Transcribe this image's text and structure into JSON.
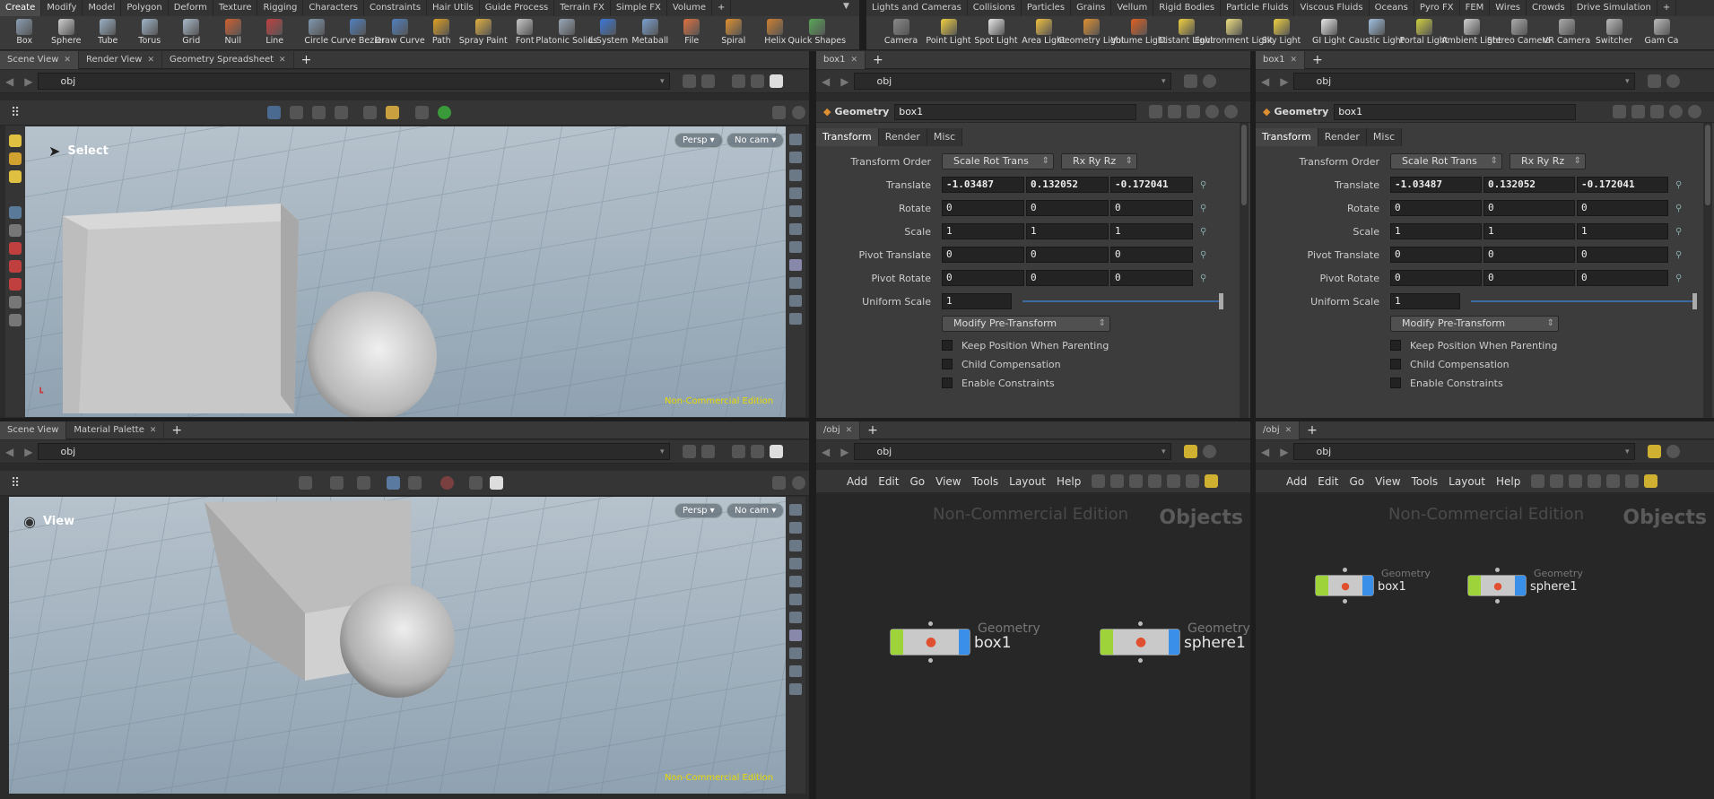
{
  "shelf_left": {
    "tabs": [
      "Create",
      "Modify",
      "Model",
      "Polygon",
      "Deform",
      "Texture",
      "Rigging",
      "Characters",
      "Constraints",
      "Hair Utils",
      "Guide Process",
      "Terrain FX",
      "Simple FX",
      "Volume"
    ],
    "tools": [
      {
        "label": "Box",
        "color": "#8a9fb4"
      },
      {
        "label": "Sphere",
        "color": "#d0d0d0"
      },
      {
        "label": "Tube",
        "color": "#9ab0c4"
      },
      {
        "label": "Torus",
        "color": "#a0b4c8"
      },
      {
        "label": "Grid",
        "color": "#a8b8c8"
      },
      {
        "label": "Null",
        "color": "#d06030"
      },
      {
        "label": "Line",
        "color": "#c04040"
      },
      {
        "label": "Circle",
        "color": "#8098b0"
      },
      {
        "label": "Curve Bezier",
        "color": "#5080c0"
      },
      {
        "label": "Draw Curve",
        "color": "#5080c0"
      },
      {
        "label": "Path",
        "color": "#e0a020"
      },
      {
        "label": "Spray Paint",
        "color": "#e0b040"
      },
      {
        "label": "Font",
        "color": "#c8c8c8"
      },
      {
        "label": "Platonic Solids",
        "color": "#9aa8b8"
      },
      {
        "label": "L-System",
        "color": "#3a78d8"
      },
      {
        "label": "Metaball",
        "color": "#7aa0d0"
      },
      {
        "label": "File",
        "color": "#e07040"
      },
      {
        "label": "Spiral",
        "color": "#e09030"
      },
      {
        "label": "Helix",
        "color": "#d08030"
      },
      {
        "label": "Quick Shapes",
        "color": "#58a858"
      }
    ]
  },
  "shelf_right": {
    "tabs": [
      "Lights and Cameras",
      "Collisions",
      "Particles",
      "Grains",
      "Vellum",
      "Rigid Bodies",
      "Particle Fluids",
      "Viscous Fluids",
      "Oceans",
      "Pyro FX",
      "FEM",
      "Wires",
      "Crowds",
      "Drive Simulation"
    ],
    "tools": [
      {
        "label": "Camera",
        "color": "#888"
      },
      {
        "label": "Point Light",
        "color": "#f0d040"
      },
      {
        "label": "Spot Light",
        "color": "#e8e8e8"
      },
      {
        "label": "Area Light",
        "color": "#f0c040"
      },
      {
        "label": "Geometry Light",
        "color": "#e09030"
      },
      {
        "label": "Volume Light",
        "color": "#e06020"
      },
      {
        "label": "Distant Light",
        "color": "#f0d040"
      },
      {
        "label": "Environment Light",
        "color": "#f0e080"
      },
      {
        "label": "Sky Light",
        "color": "#f0d040"
      },
      {
        "label": "GI Light",
        "color": "#e8e8e8"
      },
      {
        "label": "Caustic Light",
        "color": "#a0c0e0"
      },
      {
        "label": "Portal Light",
        "color": "#d0d040"
      },
      {
        "label": "Ambient Light",
        "color": "#d0d0d0"
      },
      {
        "label": "Stereo Camera",
        "color": "#aaa"
      },
      {
        "label": "VR Camera",
        "color": "#aaa"
      },
      {
        "label": "Switcher",
        "color": "#bbb"
      },
      {
        "label": "Gam Ca",
        "color": "#bbb"
      }
    ]
  },
  "top_left": {
    "tabs": [
      "Scene View",
      "Render View",
      "Geometry Spreadsheet"
    ],
    "path": "obj",
    "persp": "Persp",
    "cam": "No cam",
    "label": "Select",
    "watermark": "Non-Commercial Edition"
  },
  "bottom_left": {
    "tabs": [
      "Scene View",
      "Material Palette"
    ],
    "path": "obj",
    "persp": "Persp",
    "cam": "No cam",
    "label": "View",
    "watermark": "Non-Commercial Edition"
  },
  "params": {
    "tab": "box1",
    "path": "obj",
    "type": "Geometry",
    "node": "box1",
    "subtabs": [
      "Transform",
      "Render",
      "Misc"
    ],
    "transform_order_label": "Transform Order",
    "transform_order": "Scale Rot Trans",
    "rot_order": "Rx Ry Rz",
    "rows": [
      {
        "label": "Translate",
        "v": [
          "-1.03487",
          "0.132052",
          "-0.172041"
        ]
      },
      {
        "label": "Rotate",
        "v": [
          "0",
          "0",
          "0"
        ]
      },
      {
        "label": "Scale",
        "v": [
          "1",
          "1",
          "1"
        ]
      },
      {
        "label": "Pivot Translate",
        "v": [
          "0",
          "0",
          "0"
        ]
      },
      {
        "label": "Pivot Rotate",
        "v": [
          "0",
          "0",
          "0"
        ]
      }
    ],
    "uniform_label": "Uniform Scale",
    "uniform": "1",
    "pre": "Modify Pre-Transform",
    "checks": [
      "Keep Position When Parenting",
      "Child Compensation",
      "Enable Constraints"
    ]
  },
  "network": {
    "tab": "/obj",
    "path": "obj",
    "menus": [
      "Add",
      "Edit",
      "Go",
      "View",
      "Tools",
      "Layout",
      "Help"
    ],
    "watermark": "Non-Commercial Edition",
    "context": "Objects",
    "nodes": [
      {
        "type": "Geometry",
        "name": "box1"
      },
      {
        "type": "Geometry",
        "name": "sphere1"
      }
    ]
  }
}
